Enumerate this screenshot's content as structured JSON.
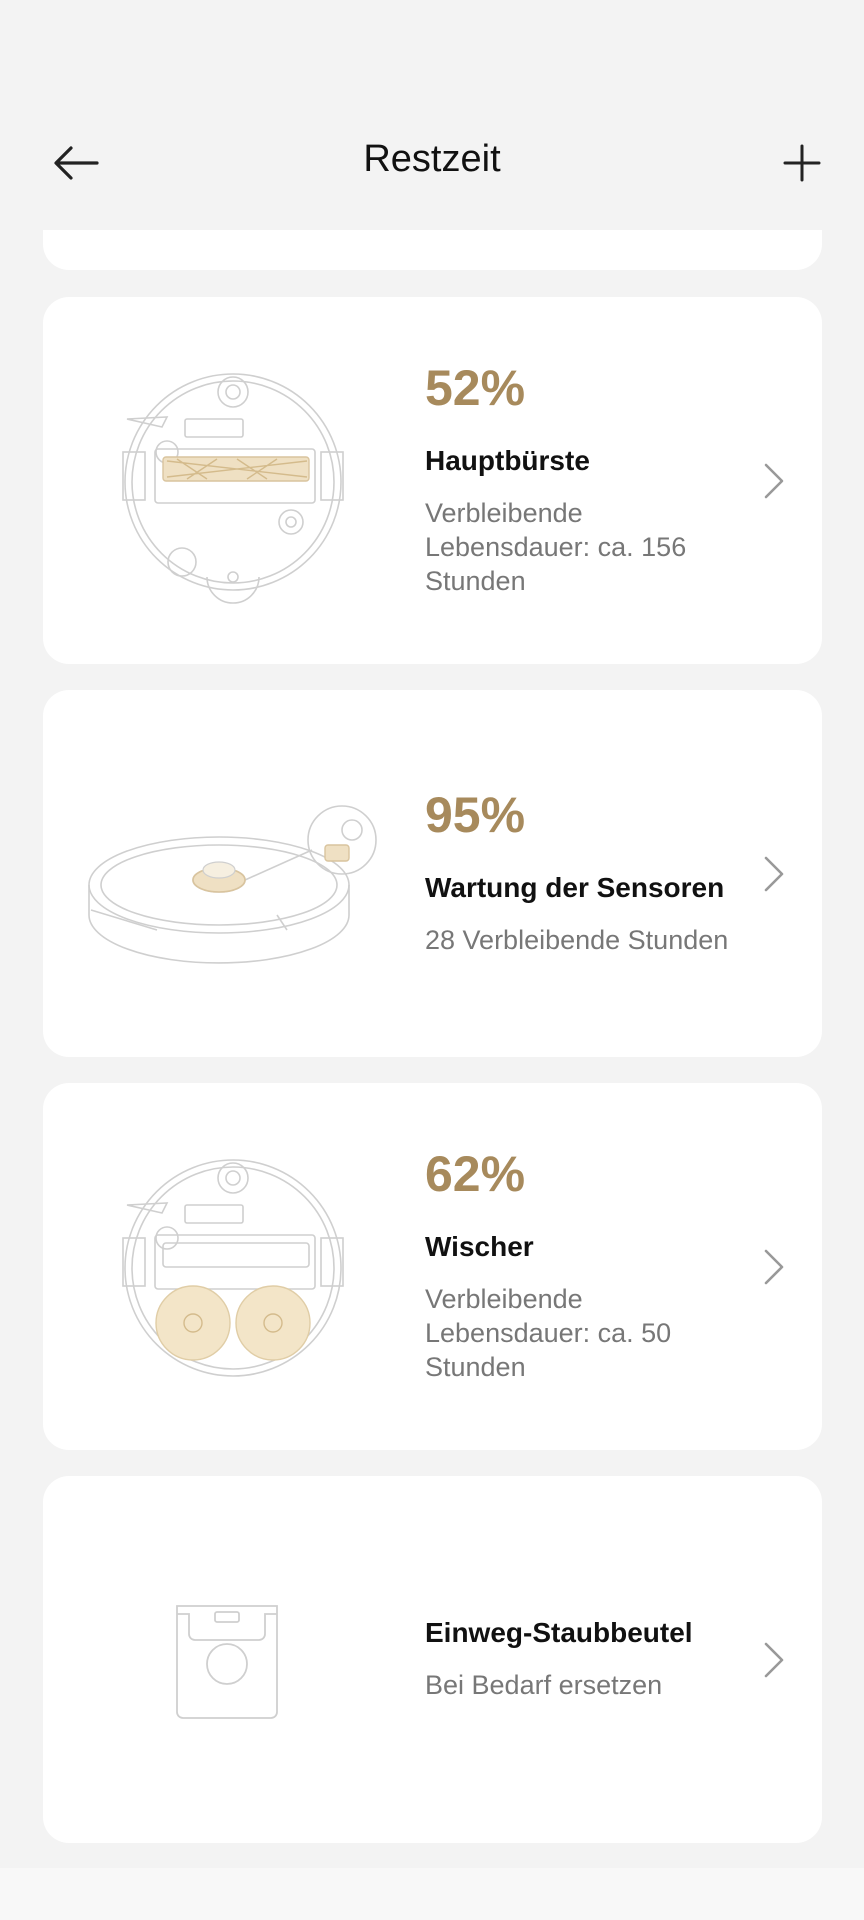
{
  "header": {
    "title": "Restzeit",
    "back_icon": "arrow-left-icon",
    "add_icon": "plus-icon"
  },
  "accent_color": "#a78a5c",
  "items": [
    {
      "percent": "52%",
      "level": 0.52,
      "name": "Hauptbürste",
      "description": "Verbleibende Lebensdauer: ca. 156 Stunden",
      "icon": "robot-main-brush-illustration"
    },
    {
      "percent": "95%",
      "level": 0.95,
      "name": "Wartung der Sensoren",
      "description": "28 Verbleibende Stunden",
      "icon": "robot-sensor-illustration"
    },
    {
      "percent": "62%",
      "level": 0.62,
      "name": "Wischer",
      "description": "Verbleibende Lebensdauer: ca. 50 Stunden",
      "icon": "robot-mop-illustration"
    },
    {
      "percent": "",
      "name": "Einweg-Staubbeutel",
      "description": "Bei Bedarf ersetzen",
      "icon": "dust-bag-illustration"
    }
  ]
}
